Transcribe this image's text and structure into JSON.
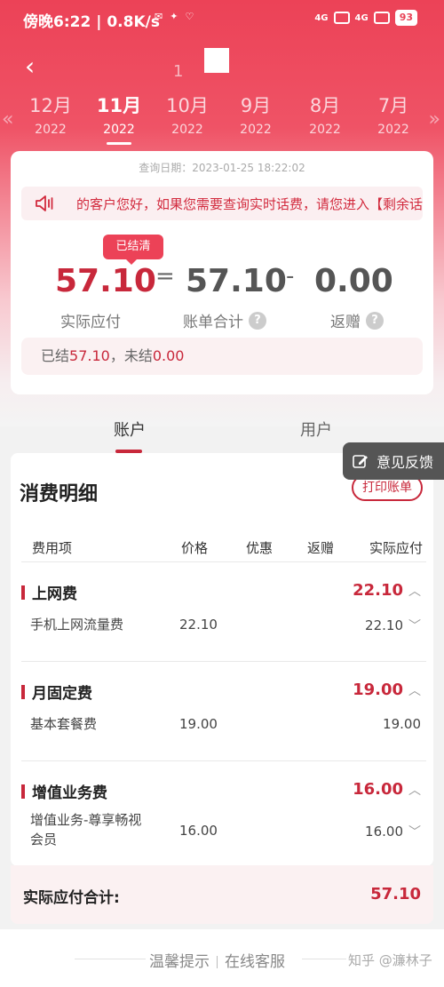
{
  "status": {
    "time": "傍晚6:22 | 0.8K/s",
    "battery": "93",
    "signal1": "4G",
    "signal2": "4G"
  },
  "nav": {
    "back_icon": "chevron-left-icon",
    "title_partial": "1"
  },
  "months": [
    {
      "month": "12月",
      "year": "2022",
      "active": false
    },
    {
      "month": "11月",
      "year": "2022",
      "active": true
    },
    {
      "month": "10月",
      "year": "2022",
      "active": false
    },
    {
      "month": "9月",
      "year": "2022",
      "active": false
    },
    {
      "month": "8月",
      "year": "2022",
      "active": false
    },
    {
      "month": "7月",
      "year": "2022",
      "active": false
    }
  ],
  "summary": {
    "query_date": "查询日期：2023-01-25 18:22:02",
    "notice": "的客户您好，如果您需要查询实时话费，请您进入【剩余话",
    "status_pill": "已结清",
    "actual_amount": "57.10",
    "equals": "=",
    "bill_total": "57.10",
    "minus": "-",
    "gift_amount": "0.00",
    "actual_label": "实际应付",
    "bill_total_label": "账单合计",
    "gift_label": "返赠",
    "settled_prefix": "已结",
    "settled_value": "57.10",
    "unsettled_prefix": "，未结",
    "unsettled_value": "0.00"
  },
  "tabs": {
    "account": "账户",
    "user": "用户"
  },
  "feedback": "意见反馈",
  "detail": {
    "title": "消费明细",
    "print_button": "打印账单",
    "headers": {
      "item": "费用项",
      "price": "价格",
      "discount": "优惠",
      "gift": "返赠",
      "actual": "实际应付"
    },
    "categories": [
      {
        "name": "上网费",
        "amount": "22.10",
        "items": [
          {
            "name": "手机上网流量费",
            "price": "22.10",
            "amount": "22.10"
          }
        ]
      },
      {
        "name": "月固定费",
        "amount": "19.00",
        "items": [
          {
            "name": "基本套餐费",
            "price": "19.00",
            "amount": "19.00"
          }
        ]
      },
      {
        "name": "增值业务费",
        "amount": "16.00",
        "items": [
          {
            "name_line1": "增值业务-尊享畅视",
            "name_line2": "会员",
            "price": "16.00",
            "amount": "16.00"
          }
        ]
      }
    ],
    "total_label": "实际应付合计:",
    "total_amount": "57.10"
  },
  "footer": {
    "tips": "温馨提示",
    "service": "在线客服",
    "watermark": "知乎 @濂林子"
  }
}
